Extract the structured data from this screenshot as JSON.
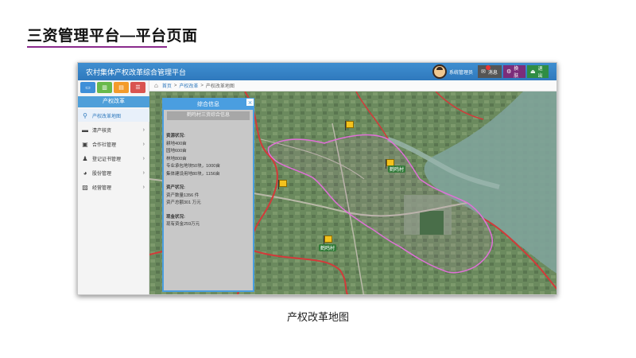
{
  "slide": {
    "title": "三资管理平台—平台页面",
    "caption": "产权改革地图",
    "accent_color": "#8a2a8c"
  },
  "app": {
    "title": "农村集体产权改革综合管理平台",
    "header_color": "#2f79bd",
    "user": {
      "name": "系统管理员",
      "avatar_icon": "user-avatar-icon"
    },
    "buttons": [
      {
        "label": "消息",
        "icon": "envelope-icon",
        "color": "#555555"
      },
      {
        "label": "换肤",
        "icon": "gear-icon",
        "color": "#7b2d7a"
      },
      {
        "label": "退出",
        "icon": "exit-icon",
        "color": "#2f8d44"
      }
    ]
  },
  "sidebar": {
    "color_tabs": [
      {
        "icon": "monitor-icon",
        "color": "#3e8fd8"
      },
      {
        "icon": "chart-icon",
        "color": "#69b94b"
      },
      {
        "icon": "document-icon",
        "color": "#f39b2a"
      },
      {
        "icon": "list-icon",
        "color": "#d9534f"
      }
    ],
    "header": "产权改革",
    "items": [
      {
        "label": "产权改革地图",
        "icon": "map-pin-icon",
        "active": true
      },
      {
        "label": "清产核资",
        "icon": "database-icon"
      },
      {
        "label": "合作社管理",
        "icon": "cooperative-icon"
      },
      {
        "label": "登记证书管理",
        "icon": "certificate-icon"
      },
      {
        "label": "股份管理",
        "icon": "pie-icon"
      },
      {
        "label": "经营管理",
        "icon": "briefcase-icon"
      }
    ]
  },
  "breadcrumb": {
    "items": [
      "首页",
      "产权改革",
      "产权改革地图"
    ],
    "separator": ">"
  },
  "info_panel": {
    "title": "综合信息",
    "subtitle": "鹤鸣村三资综合信息",
    "resources": {
      "heading": "资源状况:",
      "lines": [
        "耕地400亩",
        "园地600亩",
        "林地800亩",
        "专业承包地块50块，1000亩",
        "集体建设用地80块，1156亩"
      ]
    },
    "assets": {
      "heading": "资产状况:",
      "lines": [
        "资产数量1356 件",
        "资产总额301 万元"
      ]
    },
    "funds": {
      "heading": "现金状况:",
      "lines": [
        "现有资金259万元"
      ]
    }
  },
  "map": {
    "labels": [
      "鹤鸣村",
      "鹤鸣村"
    ],
    "boundary_color": "#e070d8",
    "border_color": "#d23a3a"
  }
}
